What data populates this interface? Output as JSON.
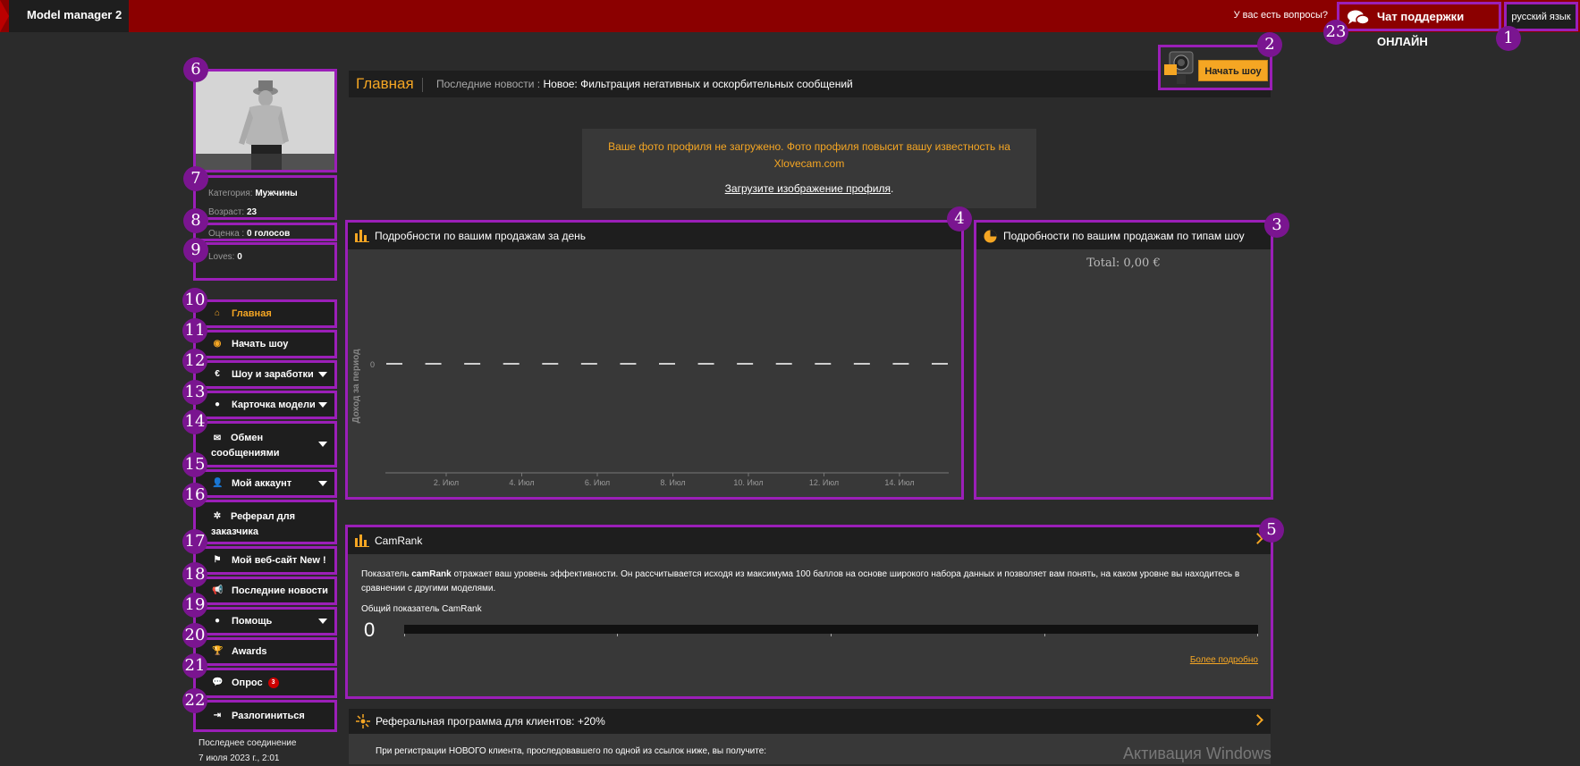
{
  "topbar": {
    "brand": "Model manager 2",
    "questions": "У вас есть вопросы?",
    "support": "Чат поддержки ОНЛАЙН",
    "language": "русский язык"
  },
  "badges": [
    "1",
    "2",
    "3",
    "4",
    "5",
    "6",
    "7",
    "8",
    "9",
    "10",
    "11",
    "12",
    "13",
    "14",
    "15",
    "16",
    "17",
    "18",
    "19",
    "20",
    "21",
    "22",
    "23"
  ],
  "profile": {
    "category_label": "Категория:",
    "category_value": "Мужчины",
    "age_label": "Возраст:",
    "age_value": "23",
    "rating_label": "Оценка :",
    "rating_value": "0 голосов",
    "loves_label": "Loves:",
    "loves_value": "0"
  },
  "nav": {
    "items": [
      {
        "label": "Главная",
        "icon": "home-icon"
      },
      {
        "label": "Начать шоу",
        "icon": "webcam-icon"
      },
      {
        "label": "Шоу и заработки",
        "icon": "euro-icon"
      },
      {
        "label": "Карточка модели",
        "icon": "user-card-icon"
      },
      {
        "label": "Обмен сообщениями",
        "icon": "envelope-icon"
      },
      {
        "label": "Мой аккаунт",
        "icon": "user-icon"
      },
      {
        "label": "Реферал для заказчика",
        "icon": "referral-icon"
      },
      {
        "label": "Мой веб-сайт New !",
        "icon": "website-icon"
      },
      {
        "label": "Последние новости",
        "icon": "megaphone-icon"
      },
      {
        "label": "Помощь",
        "icon": "help-icon"
      },
      {
        "label": "Awards",
        "icon": "trophy-icon"
      },
      {
        "label": "Опрос",
        "icon": "chat-icon",
        "badge": "3"
      },
      {
        "label": "Разлогиниться",
        "icon": "logout-icon"
      }
    ]
  },
  "last_connection": {
    "label": "Последнее соединение",
    "value": "7 июля 2023 г., 2:01"
  },
  "header": {
    "title": "Главная",
    "news_label": "Последние новости :",
    "news_value": "Новое: Фильтрация негативных и оскорбительных сообщений"
  },
  "start_show": {
    "label": "Начать шоу"
  },
  "alert": {
    "line1": "Ваше фото профиля не загружено. Фото профиля повысит вашу известность на",
    "line2": "Xlovecam.com",
    "link": "Загрузите изображение профиля",
    "link_suffix": "."
  },
  "sales_day": {
    "title": "Подробности по вашим продажам за день"
  },
  "sales_type": {
    "title": "Подробности по вашим продажам по типам шоу",
    "total": "Total: 0,00 €"
  },
  "camrank": {
    "title": "CamRank",
    "text_pre": "Показатель ",
    "text_bold": "camRank",
    "text_post": " отражает ваш уровень эффективности. Он рассчитывается исходя из максимума 100 баллов на основе широкого набора данных и позволяет вам понять, на каком уровне вы находитесь в сравнении с другими моделями.",
    "overall_label": "Общий показатель CamRank",
    "value": "0",
    "more": "Более подробно"
  },
  "referral": {
    "title": "Реферальная программа для клиентов: +20%",
    "text": "При регистрации НОВОГО клиента, проследовавшего по одной из ссылок ниже, вы получите:"
  },
  "watermark": "Активация Windows",
  "chart_data": {
    "type": "line",
    "x_ticks": [
      "2. Июл",
      "4. Июл",
      "6. Июл",
      "8. Июл",
      "10. Июл",
      "12. Июл",
      "14. Июл"
    ],
    "ylabel": "Доход за период",
    "y_ticks": [
      "0"
    ],
    "series": [
      {
        "values": [
          0,
          0,
          0,
          0,
          0,
          0,
          0,
          0,
          0,
          0,
          0,
          0,
          0,
          0,
          0
        ]
      }
    ],
    "colors": {
      "line": "#ffffff",
      "axis": "#777777"
    }
  }
}
